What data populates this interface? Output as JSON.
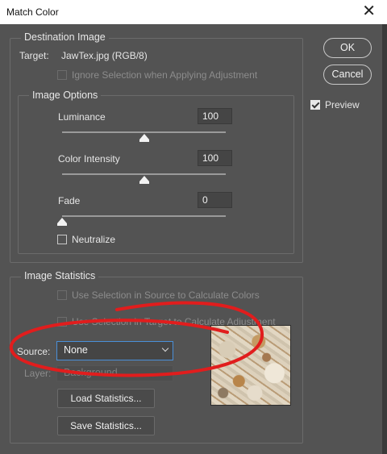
{
  "window": {
    "title": "Match Color"
  },
  "destination": {
    "legend": "Destination Image",
    "target_label": "Target:",
    "target_value": "JawTex.jpg (RGB/8)",
    "ignore_selection_label": "Ignore Selection when Applying Adjustment"
  },
  "image_options": {
    "legend": "Image Options",
    "luminance": {
      "label": "Luminance",
      "value": "100",
      "level": 0.5
    },
    "color_intensity": {
      "label": "Color Intensity",
      "value": "100",
      "level": 0.5
    },
    "fade": {
      "label": "Fade",
      "value": "0",
      "level": 0.0
    },
    "neutralize_label": "Neutralize"
  },
  "statistics": {
    "legend": "Image Statistics",
    "use_selection_source_label": "Use Selection in Source to Calculate Colors",
    "use_selection_target_label": "Use Selection in Target to Calculate Adjustment",
    "source_label": "Source:",
    "source_value": "None",
    "layer_label": "Layer:",
    "layer_value": "Background",
    "load_label": "Load Statistics...",
    "save_label": "Save Statistics..."
  },
  "buttons": {
    "ok": "OK",
    "cancel": "Cancel"
  },
  "preview": {
    "label": "Preview",
    "checked": true
  },
  "colors": {
    "background": "#535353",
    "annotation": "#e11d1d",
    "focus": "#4a8fd8"
  },
  "icons": {
    "close": "close-icon",
    "dropdown": "chevron-down-icon"
  }
}
